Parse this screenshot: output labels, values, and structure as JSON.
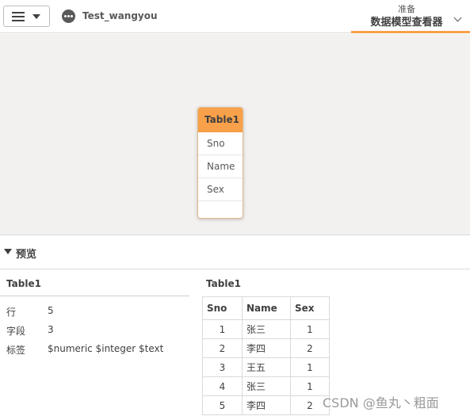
{
  "header": {
    "app_title": "Test_wangyou",
    "nav_subtitle": "准备",
    "nav_title": "数据模型查看器"
  },
  "model_canvas": {
    "table": {
      "name": "Table1",
      "fields": [
        "Sno",
        "Name",
        "Sex"
      ]
    }
  },
  "preview": {
    "label": "预览",
    "table_name": "Table1",
    "properties": [
      {
        "key": "行",
        "value": "5"
      },
      {
        "key": "字段",
        "value": "3"
      },
      {
        "key": "标签",
        "value": "$numeric $integer $text"
      }
    ],
    "data_table": {
      "title": "Table1",
      "columns": [
        "Sno",
        "Name",
        "Sex"
      ],
      "rows": [
        [
          "1",
          "张三",
          "1"
        ],
        [
          "2",
          "李四",
          "2"
        ],
        [
          "3",
          "王五",
          "1"
        ],
        [
          "4",
          "张三",
          "1"
        ],
        [
          "5",
          "李四",
          "2"
        ]
      ]
    }
  },
  "watermark": "CSDN @鱼丸丶粗面",
  "colors": {
    "accent": "#f8a04a",
    "canvas_bg": "#f2f1ef"
  }
}
